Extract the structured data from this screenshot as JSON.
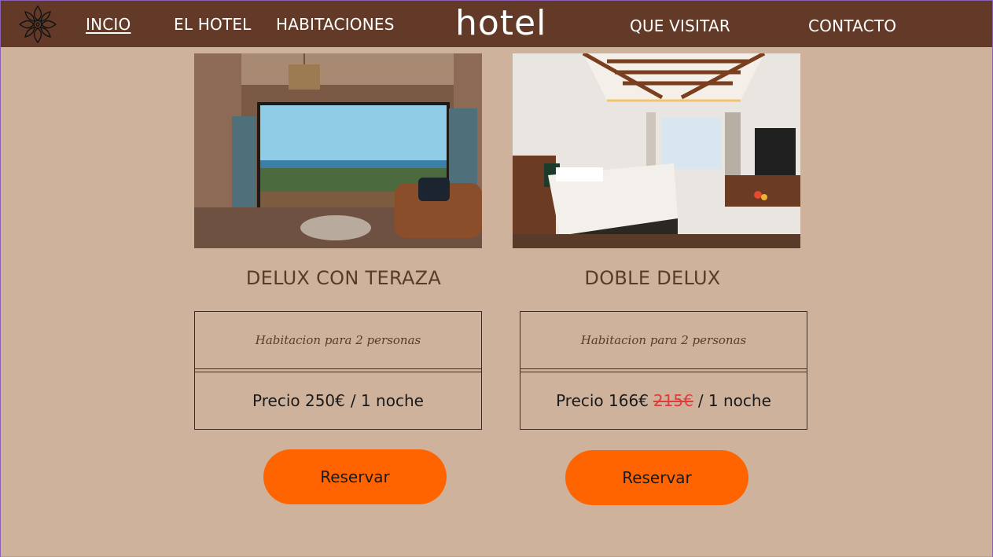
{
  "header": {
    "brand": "hotel",
    "nav": [
      {
        "label": "INCIO",
        "active": true
      },
      {
        "label": "EL HOTEL",
        "active": false
      },
      {
        "label": "HABITACIONES",
        "active": false
      },
      {
        "label": "QUE VISITAR",
        "active": false
      },
      {
        "label": "CONTACTO",
        "active": false
      }
    ],
    "logo_icon": "ornamental-mandala-icon"
  },
  "rooms": [
    {
      "title": "DELUX CON TERAZA",
      "image": "room-terrace-ocean-view-photo",
      "description": "Habitacion para 2 personas",
      "price_prefix": "Precio 250€",
      "price_old": "",
      "price_suffix": "/ 1 noche",
      "button": "Reservar"
    },
    {
      "title": "DOBLE DELUX",
      "image": "double-bedroom-photo",
      "description": "Habitacion para 2 personas",
      "price_prefix": "Precio 166€",
      "price_old": "215€",
      "price_suffix": "/ 1 noche",
      "button": "Reservar"
    }
  ],
  "colors": {
    "header_bg": "#633a28",
    "page_bg": "#cfb29b",
    "button_bg": "#ff6400",
    "old_price": "#e03a3a",
    "title_text": "#5b3a29"
  }
}
